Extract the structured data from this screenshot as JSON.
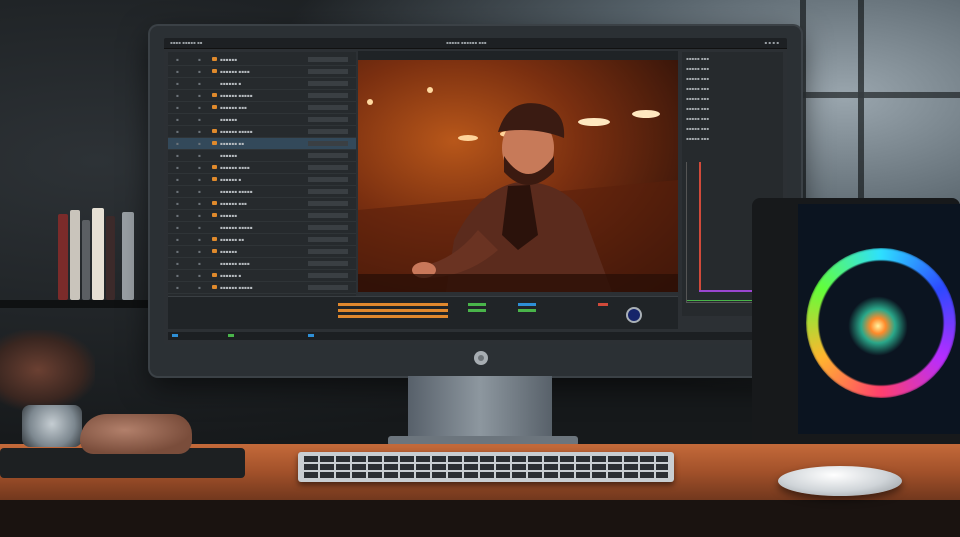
{
  "scene": {
    "subject": "Desktop monitor showing video editing software on a wooden desk",
    "accent_orange": "#d8651d",
    "timeline_colors": [
      "#e0882d",
      "#49b44a",
      "#2e8fd6",
      "#d14a3a"
    ]
  },
  "editor_ui": {
    "panels": [
      "left-project-panel",
      "viewer",
      "right-effects-panel",
      "timeline"
    ],
    "left_rows": 20,
    "viewer_content": "man in beanie and jacket, orange-lit street scene"
  }
}
